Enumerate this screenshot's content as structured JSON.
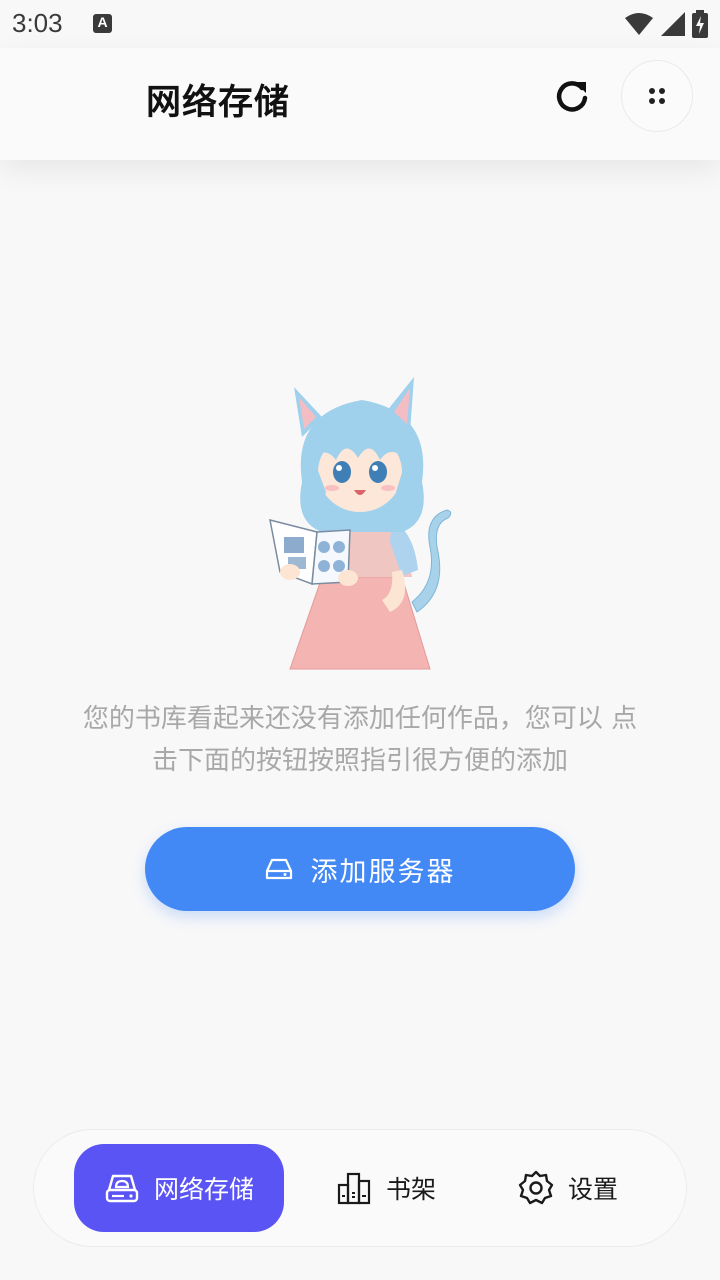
{
  "status_bar": {
    "time": "3:03",
    "notification_icon_letter": "A"
  },
  "app_bar": {
    "title": "网络存储",
    "refresh_icon": "refresh-icon",
    "more_icon": "more-dots-icon"
  },
  "empty_state": {
    "message": "您的书库看起来还没有添加任何作品，您可以 点击下面的按钮按照指引很方便的添加",
    "illustration": "cat-girl-reading-illustration"
  },
  "add_server_button": {
    "label": "添加服务器",
    "icon": "server-icon"
  },
  "bottom_nav": {
    "items": [
      {
        "label": "网络存储",
        "icon": "cloud-storage-icon",
        "active": true
      },
      {
        "label": "书架",
        "icon": "bookshelf-icon",
        "active": false
      },
      {
        "label": "设置",
        "icon": "settings-gear-icon",
        "active": false
      }
    ]
  },
  "colors": {
    "background": "#f8f8f9",
    "primary_button": "#4289f6",
    "nav_active": "#5b54f5",
    "message_text": "#a8a8a8"
  }
}
